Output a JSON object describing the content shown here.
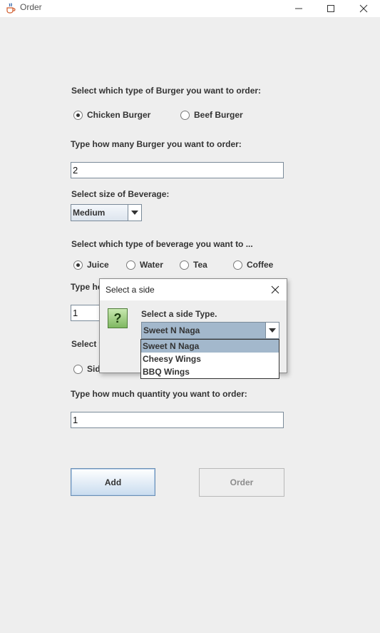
{
  "window": {
    "title": "Order"
  },
  "burger": {
    "type_label": "Select which type of Burger you want to order:",
    "options": [
      "Chicken Burger",
      "Beef Burger"
    ],
    "selected": "Chicken Burger",
    "qty_label": "Type how many Burger you want to order:",
    "qty_value": "2"
  },
  "beverage": {
    "size_label": "Select size of Beverage:",
    "size_value": "Medium",
    "type_label": "Select which type of beverage you want to ...",
    "options": [
      "Juice",
      "Water",
      "Tea",
      "Coffee"
    ],
    "selected": "Juice",
    "qty_label_partial": "Type ho",
    "qty_value": "1"
  },
  "side": {
    "label_partial": "Select t",
    "radio_partial": "Sid",
    "qty_label": "Type how much quantity you want to order:",
    "qty_value": "1"
  },
  "buttons": {
    "add": "Add",
    "order": "Order"
  },
  "dialog": {
    "title": "Select a side",
    "icon_glyph": "?",
    "message": "Select a side Type.",
    "selected": "Sweet N Naga",
    "options": [
      "Sweet N Naga",
      "Cheesy Wings",
      "BBQ Wings"
    ]
  },
  "colors": {
    "background": "#eeeeee",
    "selection": "#a3b8cc",
    "add_button_border": "#6a8fb5"
  }
}
